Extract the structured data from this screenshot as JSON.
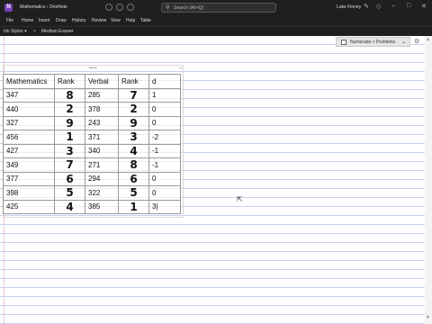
{
  "titlebar": {
    "app_icon": "N",
    "doc_title": "Mathematics  ›  OneNote",
    "search_placeholder": "Search (Alt+Q)",
    "user_name": "Luke Finney",
    "icons": [
      "pen-icon",
      "bell-icon",
      "minimize-icon",
      "restore-icon",
      "close-icon"
    ]
  },
  "menubar": {
    "items": [
      "File",
      "Home",
      "Insert",
      "Draw",
      "History",
      "Review",
      "View",
      "Help",
      "Table"
    ]
  },
  "toolbar": {
    "ink_styles": "Ink Styles ▾",
    "medium_eraser": "Medium Eraser",
    "add": "+"
  },
  "numerade": {
    "label": "Numerade > Problems",
    "dropdown_glyph": "⌄"
  },
  "table": {
    "headers": [
      "Mathematics",
      "Rank",
      "Verbal",
      "Rank",
      "d"
    ],
    "rows": [
      [
        "347",
        "8",
        "285",
        "7",
        "1"
      ],
      [
        "440",
        "2",
        "378",
        "2",
        "0"
      ],
      [
        "327",
        "9",
        "243",
        "9",
        "0"
      ],
      [
        "456",
        "1",
        "371",
        "3",
        "-2"
      ],
      [
        "427",
        "3",
        "340",
        "4",
        "-1"
      ],
      [
        "349",
        "7",
        "271",
        "8",
        "-1"
      ],
      [
        "377",
        "6",
        "294",
        "6",
        "0"
      ],
      [
        "398",
        "5",
        "322",
        "5",
        "0"
      ],
      [
        "425",
        "4",
        "385",
        "1",
        "3|"
      ]
    ]
  },
  "colors": {
    "titlebar_bg": "#1f1f1f",
    "rule_line": "#c4d2ec",
    "onenote_purple": "#7a3fb6"
  }
}
